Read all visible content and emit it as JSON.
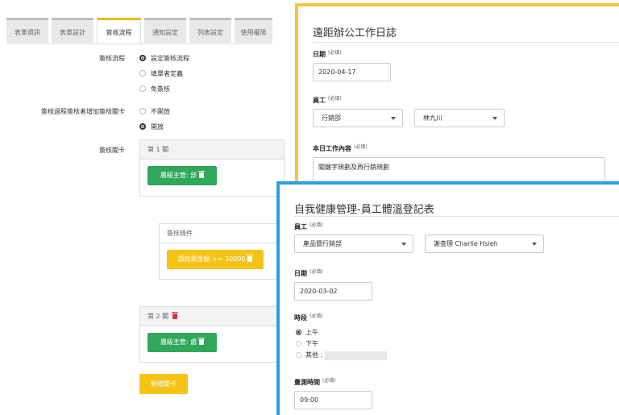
{
  "tabs": [
    {
      "label": "表單資訊"
    },
    {
      "label": "表單設計"
    },
    {
      "label": "簽核流程"
    },
    {
      "label": "通知設定"
    },
    {
      "label": "列表設定"
    },
    {
      "label": "使用權限"
    }
  ],
  "flow": {
    "flow_label": "簽核流程",
    "flow_options": [
      "設定簽核流程",
      "填單者定義",
      "免簽核"
    ],
    "add_label": "簽核過程簽核者增加簽核關卡",
    "add_options": [
      "不開放",
      "開放"
    ],
    "stage_label": "簽核關卡",
    "stage1_title": "第 1 關",
    "stage1_button": "層級主管: 部",
    "condition_title": "簽核條件",
    "condition_button": "請款單金額 >= 30000",
    "stage2_title": "第 2 關",
    "stage2_button": "層級主管: 處",
    "add_stage_button": "新增關卡"
  },
  "form1": {
    "title": "遠距辦公工作日誌",
    "required": "(必填)",
    "date_label": "日期",
    "date_value": "2020-04-17",
    "employee_label": "員工",
    "dept_value": "行銷部",
    "person_value": "林九川",
    "content_label": "本日工作內容",
    "content_value": "關鍵字規劃及再行銷規劃"
  },
  "form2": {
    "title": "自我健康管理-員工體溫登記表",
    "required": "(必填)",
    "employee_label": "員工",
    "dept_value": "產品暨行銷部",
    "person_value": "謝查理 Charlie Hsieh",
    "date_label": "日期",
    "date_value": "2020-03-02",
    "period_label": "時段",
    "period_options": [
      "上午",
      "下午",
      "其他 :"
    ],
    "time_label": "量測時間",
    "time_value": "09:00"
  },
  "colors": {
    "accent_yellow": "#f5c33b",
    "accent_blue": "#2f9ee0",
    "green_button": "#2fa85a",
    "yellow_button": "#f5c314",
    "delete_red": "#d9363e"
  }
}
